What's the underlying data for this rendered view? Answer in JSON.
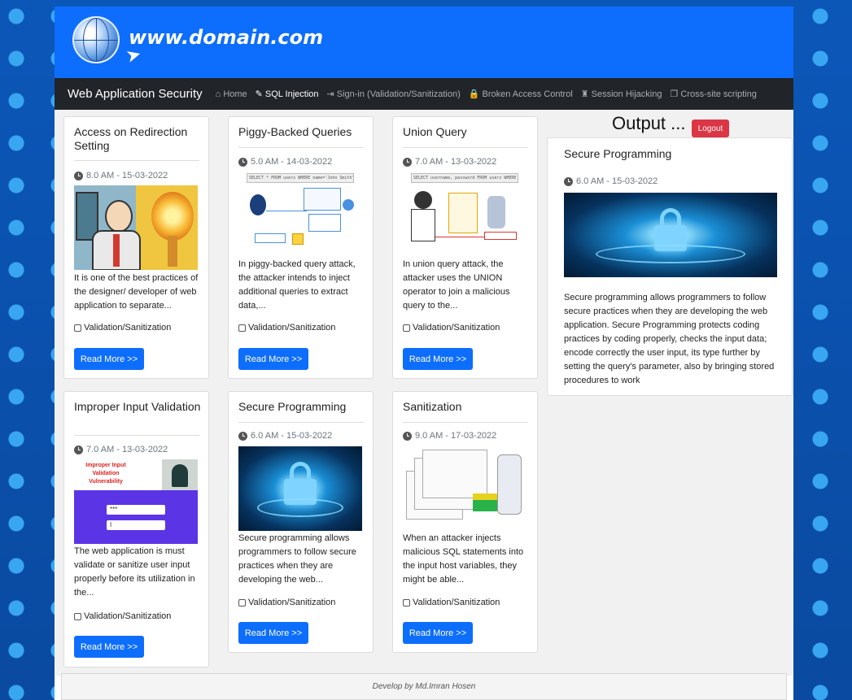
{
  "header": {
    "site_name": "www.domain.com"
  },
  "nav": {
    "brand": "Web Application Security",
    "items": [
      {
        "label": "Home",
        "icon": "home-icon",
        "glyph": "⌂",
        "active": false
      },
      {
        "label": "SQL Injection",
        "icon": "syringe-icon",
        "glyph": "✎",
        "active": true
      },
      {
        "label": "Sign-in (Validation/Sanitization)",
        "icon": "sign-in-icon",
        "glyph": "⇥",
        "active": false
      },
      {
        "label": "Broken Access Control",
        "icon": "lock-icon",
        "glyph": "🔒",
        "active": false
      },
      {
        "label": "Session Hijacking",
        "icon": "user-secret-icon",
        "glyph": "♜",
        "active": false
      },
      {
        "label": "Cross-site scripting",
        "icon": "copy-icon",
        "glyph": "❐",
        "active": false
      }
    ]
  },
  "cards": [
    {
      "title": "Access on Redirection Setting",
      "time": "8.0 AM - 15-03-2022",
      "desc": "It is one of the best practices of the designer/ developer of web application to separate...",
      "check": "Validation/Sanitization",
      "button": "Read More >>"
    },
    {
      "title": "Piggy-Backed Queries",
      "time": "5.0 AM - 14-03-2022",
      "desc": "In piggy-backed query attack, the attacker intends to inject additional queries to extract data,...",
      "check": "Validation/Sanitization",
      "button": "Read More >>"
    },
    {
      "title": "Union Query",
      "time": "7.0 AM - 13-03-2022",
      "desc": "In union query attack, the attacker uses the UNION operator to join a malicious query to the...",
      "check": "Validation/Sanitization",
      "button": "Read More >>"
    },
    {
      "title": "Improper Input Validation",
      "time": "7.0 AM - 13-03-2022",
      "desc": "The web application is must validate or sanitize user input properly before its utilization in the...",
      "check": "Validation/Sanitization",
      "button": "Read More >>"
    },
    {
      "title": "Secure Programming",
      "time": "6.0 AM - 15-03-2022",
      "desc": "Secure programming allows programmers to follow secure practices when they are developing the web...",
      "check": "Validation/Sanitization",
      "button": "Read More >>"
    },
    {
      "title": "Sanitization",
      "time": "9.0 AM - 17-03-2022",
      "desc": "When an attacker injects malicious SQL statements into the input host variables, they might be able...",
      "check": "Validation/Sanitization",
      "button": "Read More >>"
    }
  ],
  "thumbs": {
    "piggy_code": "SELECT * FROM users WHERE name='John Smith' -- and password=anything",
    "union_code": "SELECT username, password FROM users WHERE ...",
    "improper_title": "Improper Input Validation Vulnerability",
    "improper_field1": "***",
    "improper_field2": "I"
  },
  "output": {
    "heading": "Output ...",
    "logout": "Logout",
    "title": "Secure Programming",
    "time": "6.0 AM - 15-03-2022",
    "desc": "Secure programming allows programmers to follow secure practices when they are developing the web application. Secure Programming protects coding practices by coding properly, checks the input data; encode correctly the user input, its type further by setting the query's parameter, also by bringing stored procedures to work"
  },
  "footer": {
    "text": "Develop by Md.Imran Hosen"
  },
  "colors": {
    "primary": "#0d6efd",
    "navbar": "#212529",
    "danger": "#dc3545"
  }
}
